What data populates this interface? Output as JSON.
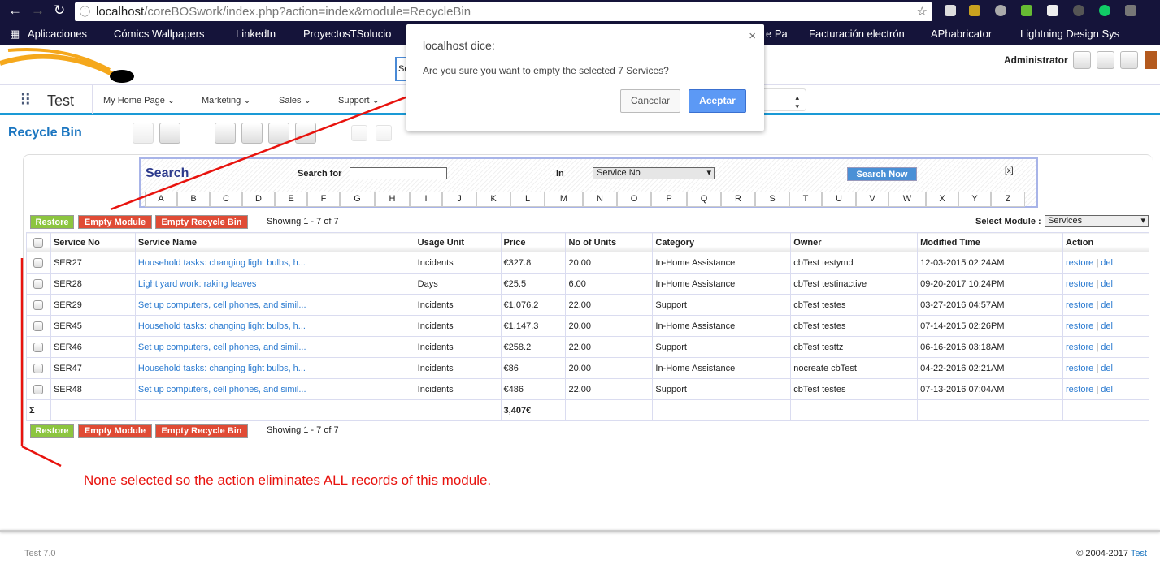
{
  "browser": {
    "url_host": "localhost",
    "url_path": "/coreBOSwork/index.php?action=index&module=RecycleBin",
    "bookmarks": [
      "Aplicaciones",
      "Cómics Wallpapers",
      "LinkedIn",
      "ProyectosTSolucio",
      "e Pa",
      "Facturación electrón",
      "APhabricator",
      "Lightning Design Sys"
    ]
  },
  "header": {
    "user": "Administrator",
    "search_placeholder": "Se",
    "app_name": "Test"
  },
  "nav": {
    "items": [
      "My Home Page",
      "Marketing",
      "Sales",
      "Support"
    ]
  },
  "page": {
    "title": "Recycle Bin"
  },
  "search": {
    "title": "Search",
    "search_for_label": "Search for",
    "search_value": "",
    "in_label": "In",
    "in_value": "Service No",
    "button": "Search Now",
    "close": "[x]",
    "letters": [
      "A",
      "B",
      "C",
      "D",
      "E",
      "F",
      "G",
      "H",
      "I",
      "J",
      "K",
      "L",
      "M",
      "N",
      "O",
      "P",
      "Q",
      "R",
      "S",
      "T",
      "U",
      "V",
      "W",
      "X",
      "Y",
      "Z"
    ]
  },
  "actions": {
    "restore": "Restore",
    "empty_module": "Empty Module",
    "empty_bin": "Empty Recycle Bin",
    "showing": "Showing 1 - 7 of 7",
    "select_module_label": "Select Module :",
    "select_module_value": "Services"
  },
  "table": {
    "columns": [
      "Service No",
      "Service Name",
      "Usage Unit",
      "Price",
      "No of Units",
      "Category",
      "Owner",
      "Modified Time",
      "Action"
    ],
    "rows": [
      [
        "SER27",
        "Household tasks: changing light bulbs, h...",
        "Incidents",
        "€327.8",
        "20.00",
        "In-Home Assistance",
        "cbTest testymd",
        "12-03-2015 02:24AM"
      ],
      [
        "SER28",
        "Light yard work: raking leaves",
        "Days",
        "€25.5",
        "6.00",
        "In-Home Assistance",
        "cbTest testinactive",
        "09-20-2017 10:24PM"
      ],
      [
        "SER29",
        "Set up computers, cell phones, and simil...",
        "Incidents",
        "€1,076.2",
        "22.00",
        "Support",
        "cbTest testes",
        "03-27-2016 04:57AM"
      ],
      [
        "SER45",
        "Household tasks: changing light bulbs, h...",
        "Incidents",
        "€1,147.3",
        "20.00",
        "In-Home Assistance",
        "cbTest testes",
        "07-14-2015 02:26PM"
      ],
      [
        "SER46",
        "Set up computers, cell phones, and simil...",
        "Incidents",
        "€258.2",
        "22.00",
        "Support",
        "cbTest testtz",
        "06-16-2016 03:18AM"
      ],
      [
        "SER47",
        "Household tasks: changing light bulbs, h...",
        "Incidents",
        "€86",
        "20.00",
        "In-Home Assistance",
        "nocreate cbTest",
        "04-22-2016 02:21AM"
      ],
      [
        "SER48",
        "Set up computers, cell phones, and simil...",
        "Incidents",
        "€486",
        "22.00",
        "Support",
        "cbTest testes",
        "07-13-2016 07:04AM"
      ]
    ],
    "restore_link": "restore",
    "sep": "|",
    "del_link": "del",
    "sum_symbol": "Σ",
    "sum_price": "3,407€"
  },
  "annotation": "None selected so the action eliminates ALL records of this module.",
  "footer": {
    "version": "Test 7.0",
    "copyright": "© 2004-2017 ",
    "link": "Test"
  },
  "dialog": {
    "title": "localhost dice:",
    "message": "Are you sure you want to empty the selected 7 Services?",
    "cancel": "Cancelar",
    "accept": "Aceptar",
    "close": "×"
  },
  "colors": {
    "accent": "#1a9ad6",
    "restore": "#8cc53f",
    "danger": "#e04b35",
    "annotation": "#e8130e"
  }
}
